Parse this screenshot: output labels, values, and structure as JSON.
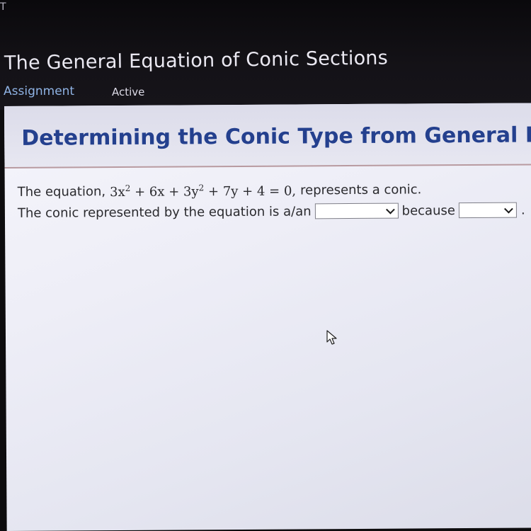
{
  "corner": {
    "glyph": "T"
  },
  "header": {
    "title": "The General Equation of Conic Sections",
    "assignment_label": "Assignment",
    "status": "Active"
  },
  "section": {
    "title": "Determining the Conic Type from General Form"
  },
  "question": {
    "line1_prefix": "The equation,",
    "equation": {
      "t1_coef": "3x",
      "t1_exp": "2",
      "t2": " + 6x + 3y",
      "t2_exp": "2",
      "t3": " + 7y + 4 = 0,"
    },
    "line1_suffix": "represents a conic.",
    "line2_prefix": "The conic represented by the equation is a/an",
    "dropdown1": {
      "selected": ""
    },
    "because_label": "because",
    "dropdown2": {
      "selected": ""
    },
    "period": "."
  },
  "icons": {
    "dropdown_arrow": "chevron-down-icon",
    "cursor": "mouse-pointer-icon"
  },
  "colors": {
    "header_bg": "#141217",
    "assignment_link": "#8fb3e4",
    "section_title": "#24408e",
    "content_bg": "#eeeef7",
    "banner_border": "#b89aa0"
  }
}
